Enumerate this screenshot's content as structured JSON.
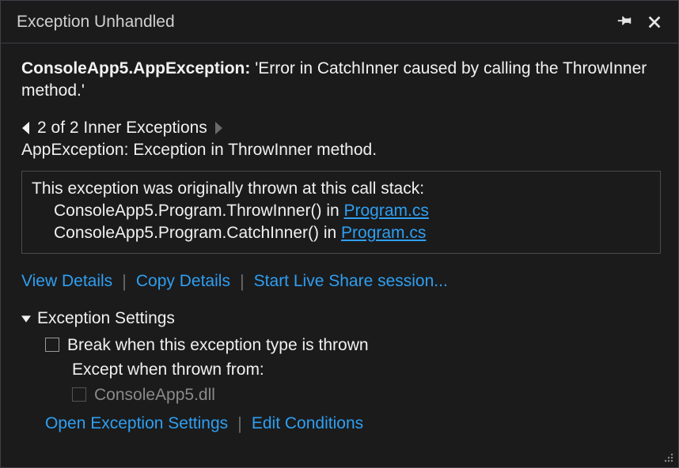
{
  "title": "Exception Unhandled",
  "exception": {
    "type": "ConsoleApp5.AppException:",
    "message": "'Error in CatchInner caused by calling the ThrowInner method.'"
  },
  "inner": {
    "nav_text": "2 of 2 Inner Exceptions",
    "desc": "AppException: Exception in ThrowInner method."
  },
  "callstack": {
    "intro": "This exception was originally thrown at this call stack:",
    "frames": [
      {
        "loc": "ConsoleApp5.Program.ThrowInner() in ",
        "file": "Program.cs"
      },
      {
        "loc": "ConsoleApp5.Program.CatchInner() in ",
        "file": "Program.cs"
      }
    ]
  },
  "actions": {
    "view_details": "View Details",
    "copy_details": "Copy Details",
    "live_share": "Start Live Share session..."
  },
  "settings": {
    "header": "Exception Settings",
    "break_when": "Break when this exception type is thrown",
    "except_when": "Except when thrown from:",
    "module": "ConsoleApp5.dll",
    "open_settings": "Open Exception Settings",
    "edit_conditions": "Edit Conditions"
  }
}
